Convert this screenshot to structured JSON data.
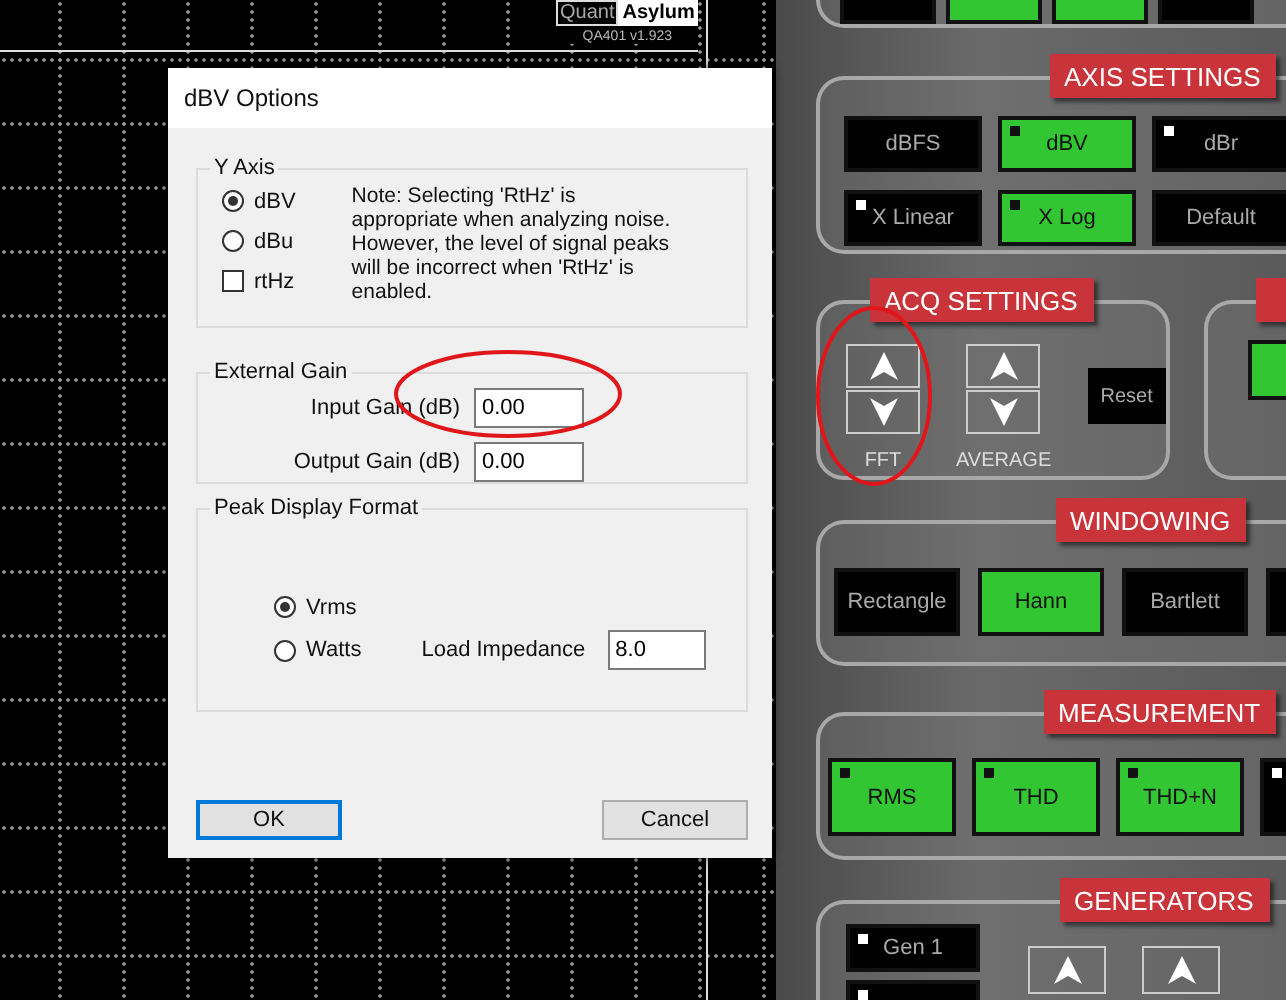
{
  "plot": {
    "logo": {
      "outlined": "Quant",
      "filled": "Asylum"
    },
    "version": "QA401 v1.923"
  },
  "dialog": {
    "title": "dBV Options",
    "y_axis": {
      "label": "Y Axis",
      "options": [
        {
          "label": "dBV",
          "kind": "radio",
          "selected": true
        },
        {
          "label": "dBu",
          "kind": "radio",
          "selected": false
        },
        {
          "label": "rtHz",
          "kind": "checkbox",
          "checked": false
        }
      ],
      "note": "Note: Selecting 'RtHz' is appropriate when analyzing noise. However, the level of signal peaks will be incorrect when 'RtHz' is enabled."
    },
    "external_gain": {
      "label": "External Gain",
      "fields": [
        {
          "label": "Input Gain (dB)",
          "value": "0.00"
        },
        {
          "label": "Output Gain (dB)",
          "value": "0.00"
        }
      ]
    },
    "peak_display_format": {
      "label": "Peak Display Format",
      "options": [
        {
          "label": "Vrms",
          "selected": true
        },
        {
          "label": "Watts",
          "selected": false
        }
      ],
      "load_impedance": {
        "label": "Load Impedance",
        "value": "8.0"
      }
    },
    "buttons": [
      {
        "label": "OK",
        "default": true
      },
      {
        "label": "Cancel",
        "default": false
      }
    ]
  },
  "panel": {
    "top_section": {
      "buttons": [
        {
          "selected": false,
          "indicator": false
        },
        {
          "selected": true,
          "indicator": false
        },
        {
          "selected": true,
          "indicator": false
        },
        {
          "selected": false,
          "indicator": false
        }
      ]
    },
    "axis_settings": {
      "title": "AXIS SETTINGS",
      "buttons": [
        {
          "label": "dBFS",
          "selected": false,
          "indicator": false
        },
        {
          "label": "dBV",
          "selected": true,
          "indicator": true
        },
        {
          "label": "dBr",
          "selected": false,
          "indicator": true
        },
        {
          "label": "X Linear",
          "selected": false,
          "indicator": true
        },
        {
          "label": "X Log",
          "selected": true,
          "indicator": true
        },
        {
          "label": "Default",
          "selected": false,
          "indicator": false
        }
      ]
    },
    "acq_settings": {
      "title": "ACQ SETTINGS",
      "steppers": [
        {
          "label": "FFT"
        },
        {
          "label": "AVERAGE"
        }
      ],
      "reset": "Reset"
    },
    "side_section": {
      "buttons": [
        {
          "selected": true,
          "indicator": false
        }
      ]
    },
    "windowing": {
      "title": "WINDOWING",
      "buttons": [
        {
          "label": "Rectangle",
          "selected": false,
          "indicator": false
        },
        {
          "label": "Hann",
          "selected": true,
          "indicator": false
        },
        {
          "label": "Bartlett",
          "selected": false,
          "indicator": false
        },
        {
          "selected": false,
          "indicator": false
        }
      ]
    },
    "measurement": {
      "title": "MEASUREMENT",
      "buttons": [
        {
          "label": "RMS",
          "selected": true,
          "indicator": true
        },
        {
          "label": "THD",
          "selected": true,
          "indicator": true
        },
        {
          "label": "THD+N",
          "selected": true,
          "indicator": true
        },
        {
          "selected": false,
          "indicator": true
        }
      ]
    },
    "generators": {
      "title": "GENERATORS",
      "buttons": [
        {
          "label": "Gen 1",
          "selected": false,
          "indicator": true
        },
        {
          "selected": false,
          "indicator": true
        }
      ]
    }
  }
}
